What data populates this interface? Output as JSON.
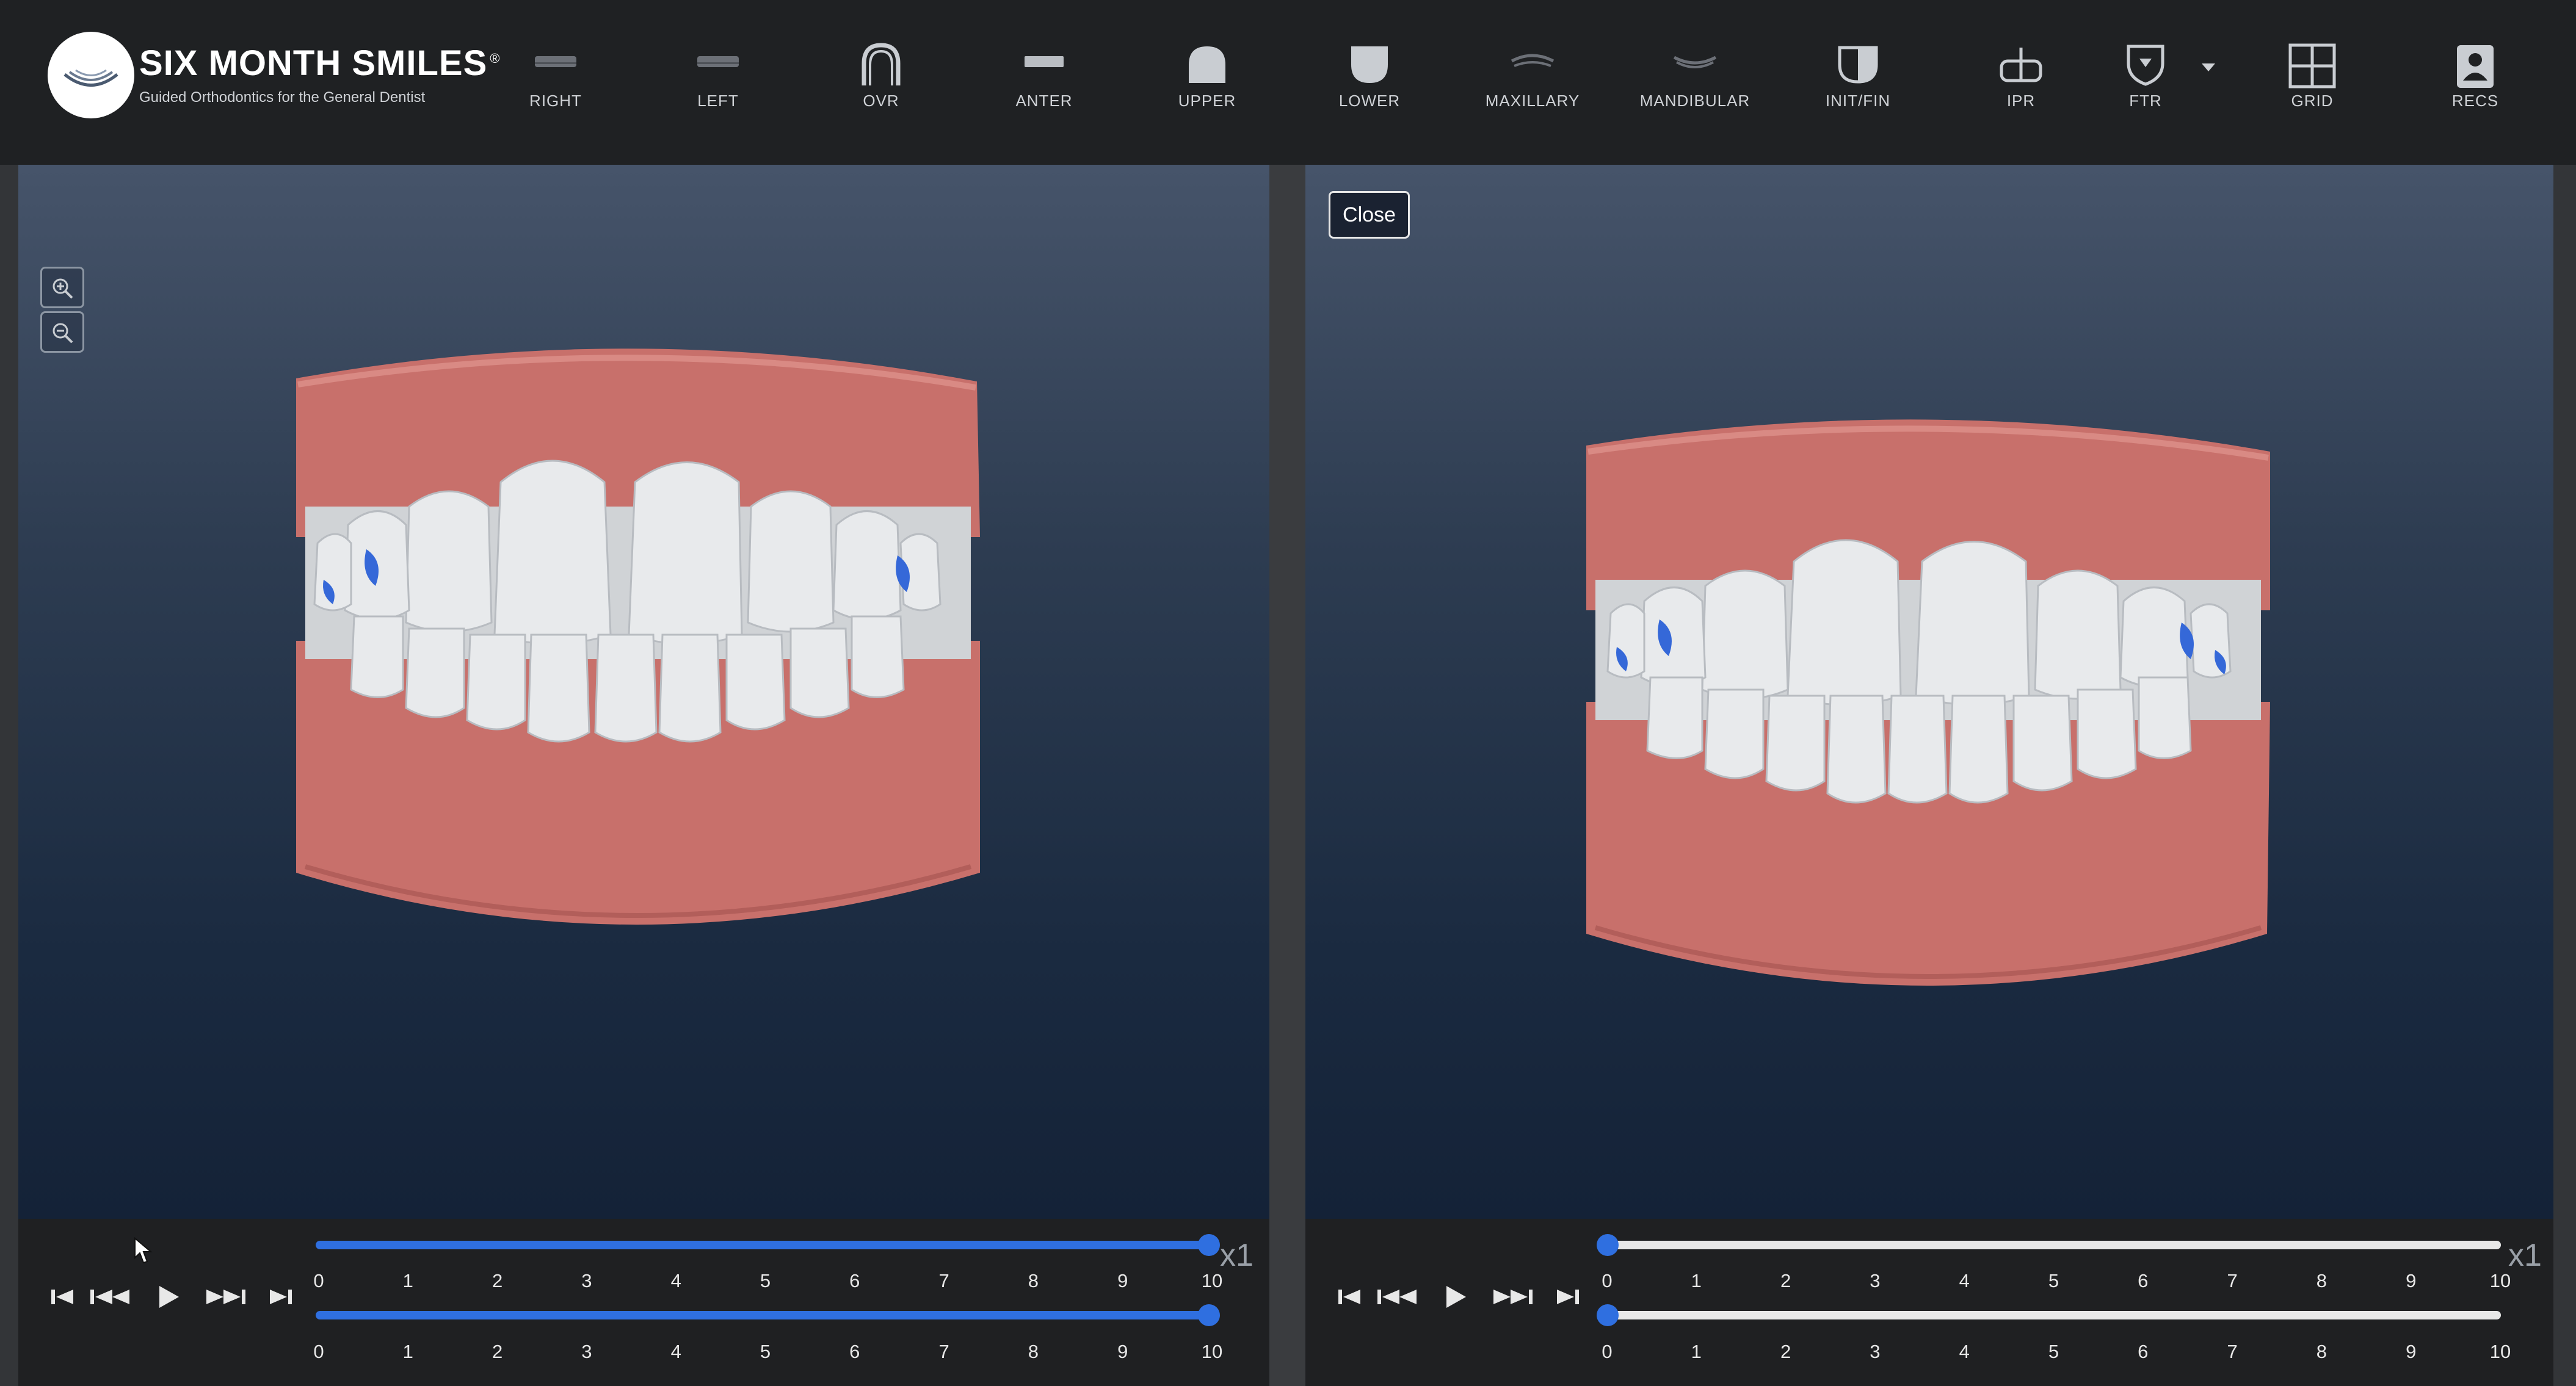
{
  "brand": {
    "name": "SIX MONTH SMILES",
    "mark": "®",
    "tagline": "Guided Orthodontics for the General Dentist"
  },
  "toolbar": [
    {
      "label": "RIGHT",
      "icon": "right-view-icon"
    },
    {
      "label": "LEFT",
      "icon": "left-view-icon"
    },
    {
      "label": "OVR",
      "icon": "overjet-arch-icon"
    },
    {
      "label": "ANTER",
      "icon": "anterior-view-icon"
    },
    {
      "label": "UPPER",
      "icon": "upper-jaw-icon"
    },
    {
      "label": "LOWER",
      "icon": "lower-jaw-icon"
    },
    {
      "label": "MAXILLARY",
      "icon": "maxillary-icon"
    },
    {
      "label": "MANDIBULAR",
      "icon": "mandibular-icon"
    },
    {
      "label": "INIT/FIN",
      "icon": "init-fin-icon"
    },
    {
      "label": "IPR",
      "icon": "ipr-icon"
    },
    {
      "label": "FTR",
      "icon": "ftr-shield-icon"
    },
    {
      "label": "GRID",
      "icon": "grid-icon"
    },
    {
      "label": "RECS",
      "icon": "records-icon"
    }
  ],
  "left_view": {
    "zoom_in": "zoom-in-icon",
    "zoom_out": "zoom-out-icon"
  },
  "right_view": {
    "close_label": "Close"
  },
  "timeline": {
    "ticks": [
      "0",
      "1",
      "2",
      "3",
      "4",
      "5",
      "6",
      "7",
      "8",
      "9",
      "10"
    ],
    "speed": "x1",
    "left": {
      "upper_stage": 10,
      "lower_stage": 10
    },
    "right": {
      "upper_stage": 0,
      "lower_stage": 0
    }
  },
  "colors": {
    "accent": "#2f6fe0",
    "gum": "#c8706b",
    "tooth": "#e4e6e8",
    "attachment": "#3568d8"
  }
}
